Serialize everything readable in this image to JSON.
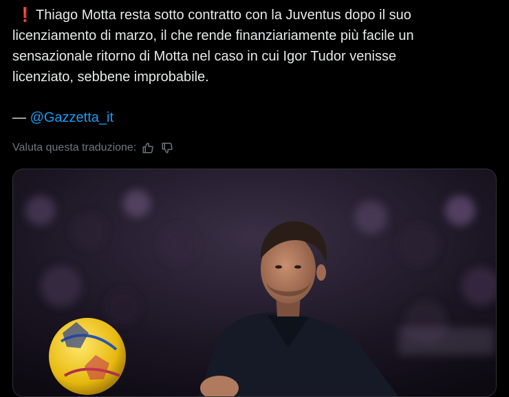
{
  "tweet": {
    "lines": [
      "Thiago Motta resta sotto contratto con la Juventus dopo il suo",
      "licenziamento di marzo, il che rende finanziariamente più facile un",
      "sensazionale ritorno di Motta nel caso in cui Igor Tudor venisse",
      "licenziato, sebbene improbabile."
    ],
    "excl_icon": "❗",
    "source_prefix": "— ",
    "source_handle": "@Gazzetta_it"
  },
  "translation_feedback": {
    "label": "Valuta questa traduzione:",
    "like_icon": "thumbs-up-icon",
    "dislike_icon": "thumbs-down-icon"
  },
  "colors": {
    "background": "#000000",
    "text": "#e7e9ea",
    "muted": "#71767b",
    "link": "#1d9bf0",
    "alert": "#f4212e"
  }
}
